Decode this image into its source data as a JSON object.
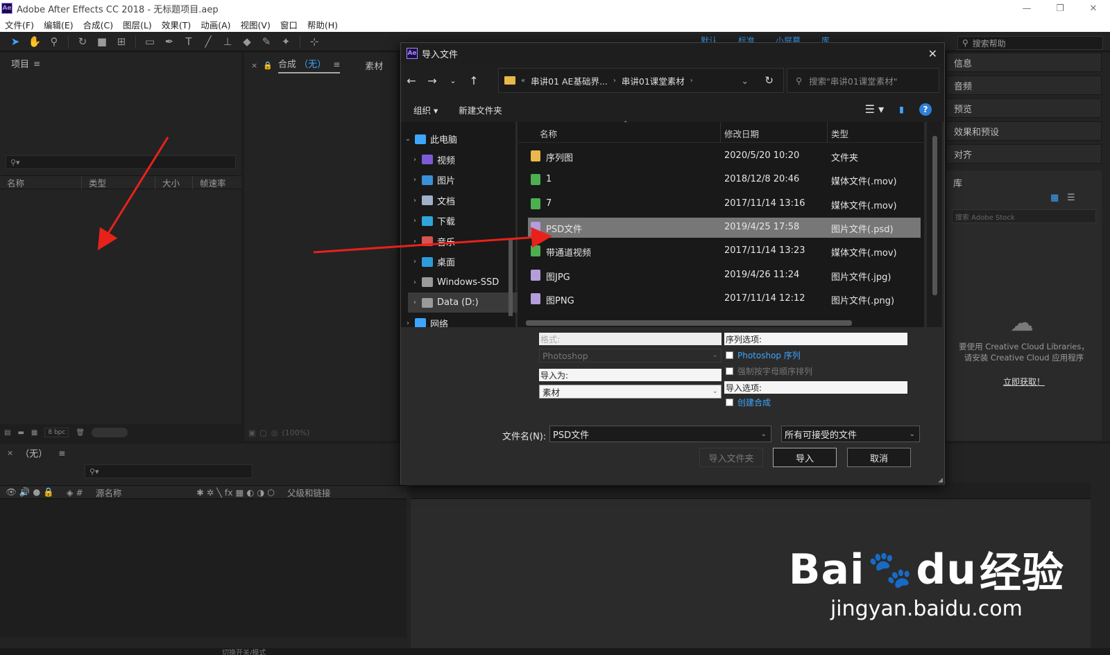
{
  "window": {
    "title": "Adobe After Effects CC 2018 - 无标题项目.aep",
    "logo": "Ae",
    "controls": [
      "—",
      "❐",
      "✕"
    ]
  },
  "menu": [
    "文件(F)",
    "编辑(E)",
    "合成(C)",
    "图层(L)",
    "效果(T)",
    "动画(A)",
    "视图(V)",
    "窗口",
    "帮助(H)"
  ],
  "help": {
    "placeholder": "搜索帮助"
  },
  "workspace": {
    "tab1": "默认",
    "tab2": "标准",
    "tab3": "小屏幕",
    "tab4": "库"
  },
  "project": {
    "title": "项目",
    "cols": {
      "name": "名称",
      "type": "类型",
      "size": "大小",
      "fps": "帧速率"
    },
    "bpc": "8 bpc"
  },
  "comp": {
    "tab_prefix": "合成",
    "tab_none": "（无）",
    "footage_tab": "素材",
    "zoom": "(100%)"
  },
  "timeline": {
    "tab": "（无）",
    "cols": {
      "source": "源名称",
      "parent": "父级和链接"
    },
    "mode": "切换开关/模式"
  },
  "right_panels": {
    "info": "信息",
    "audio": "音频",
    "preview": "预览",
    "effects": "效果和预设",
    "align": "对齐",
    "library": "库",
    "stock_placeholder": "搜索 Adobe Stock",
    "cc_message_1": "要使用 Creative Cloud Libraries，",
    "cc_message_2": "请安装 Creative Cloud 应用程序",
    "cc_link": "立即获取！"
  },
  "dialog": {
    "title": "导入文件",
    "breadcrumb": [
      "串讲01 AE基础界...",
      "串讲01课堂素材"
    ],
    "search_placeholder": "搜索\"串讲01课堂素材\"",
    "organize": "组织",
    "new_folder": "新建文件夹",
    "help": "?",
    "tree": [
      {
        "label": "此电脑",
        "icon": "pc-icon",
        "color": "#3ea6ff"
      },
      {
        "label": "视频",
        "icon": "video-icon",
        "color": "#7b5cd6"
      },
      {
        "label": "图片",
        "icon": "picture-icon",
        "color": "#3a8fd9"
      },
      {
        "label": "文档",
        "icon": "document-icon",
        "color": "#9fb0c8"
      },
      {
        "label": "下载",
        "icon": "download-icon",
        "color": "#2fa6d9"
      },
      {
        "label": "音乐",
        "icon": "music-icon",
        "color": "#d9534f"
      },
      {
        "label": "桌面",
        "icon": "desktop-icon",
        "color": "#2e9cd9"
      },
      {
        "label": "Windows-SSD",
        "icon": "drive-icon",
        "color": "#9a9a9a"
      },
      {
        "label": "Data (D:)",
        "icon": "drive-icon",
        "color": "#9a9a9a"
      },
      {
        "label": "网络",
        "icon": "network-icon",
        "color": "#3ea6ff"
      }
    ],
    "columns": {
      "name": "名称",
      "date": "修改日期",
      "type": "类型"
    },
    "files": [
      {
        "name": "序列图",
        "date": "2020/5/20 10:20",
        "type": "文件夹",
        "icon": "folder-icon",
        "color": "#e8b84a"
      },
      {
        "name": "1",
        "date": "2018/12/8 20:46",
        "type": "媒体文件(.mov)",
        "icon": "media-file-icon",
        "color": "#4caf50"
      },
      {
        "name": "7",
        "date": "2017/11/14 13:16",
        "type": "媒体文件(.mov)",
        "icon": "media-file-icon",
        "color": "#4caf50"
      },
      {
        "name": "PSD文件",
        "date": "2019/4/25 17:58",
        "type": "图片文件(.psd)",
        "icon": "image-file-icon",
        "color": "#b39ddb"
      },
      {
        "name": "带通道视频",
        "date": "2017/11/14 13:23",
        "type": "媒体文件(.mov)",
        "icon": "media-file-icon",
        "color": "#4caf50"
      },
      {
        "name": "图JPG",
        "date": "2019/4/26 11:24",
        "type": "图片文件(.jpg)",
        "icon": "image-file-icon",
        "color": "#b39ddb"
      },
      {
        "name": "图PNG",
        "date": "2017/11/14 12:12",
        "type": "图片文件(.png)",
        "icon": "image-file-icon",
        "color": "#b39ddb"
      }
    ],
    "format_label": "格式:",
    "format_value": "Photoshop",
    "import_as_label": "导入为:",
    "import_as_value": "素材",
    "sequence_label": "序列选项:",
    "seq_option1": "Photoshop 序列",
    "seq_option2": "强制按字母顺序排列",
    "import_options_label": "导入选项:",
    "create_comp": "创建合成",
    "filename_label": "文件名(N):",
    "filename_value": "PSD文件",
    "filetype_value": "所有可接受的文件",
    "btn_import_folder": "导入文件夹",
    "btn_import": "导入",
    "btn_cancel": "取消"
  },
  "watermark": {
    "brand_a": "Bai",
    "brand_b": "du",
    "brand_c": "经验",
    "url": "jingyan.baidu.com"
  },
  "colors": {
    "accent": "#3ea6ff",
    "arrow": "#e8221b",
    "panel": "#232323",
    "dialog": "#2b2b2b"
  }
}
